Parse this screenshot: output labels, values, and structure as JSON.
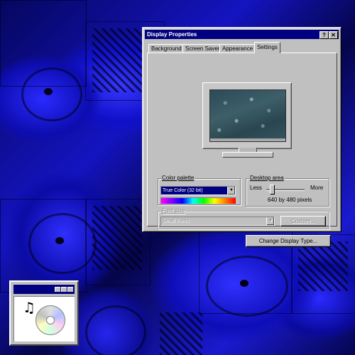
{
  "window": {
    "title": "Display Properties",
    "help_glyph": "?",
    "close_glyph": "✕"
  },
  "tabs": [
    {
      "label": "Background"
    },
    {
      "label": "Screen Saver"
    },
    {
      "label": "Appearance"
    },
    {
      "label": "Settings"
    }
  ],
  "color_palette": {
    "label": "Color palette",
    "selected": "True Color (32 bit)"
  },
  "desktop_area": {
    "label": "Desktop area",
    "less_label": "Less",
    "more_label": "More",
    "resolution": "640 by 480 pixels",
    "slider_level": 0.1
  },
  "font_size": {
    "label": "Font size",
    "selected": "Small Fonts",
    "custom_button": "Custom..."
  },
  "change_display_type_button": "Change Display Type...",
  "icons": {
    "wallpaper": "computer-wallpaper",
    "shortcut": "cd-audio-player-icon",
    "music_note": "♫"
  },
  "colors": {
    "title_bar": "#000080",
    "window_face": "#c0c0c0",
    "desktop": "#0a0a8a"
  }
}
